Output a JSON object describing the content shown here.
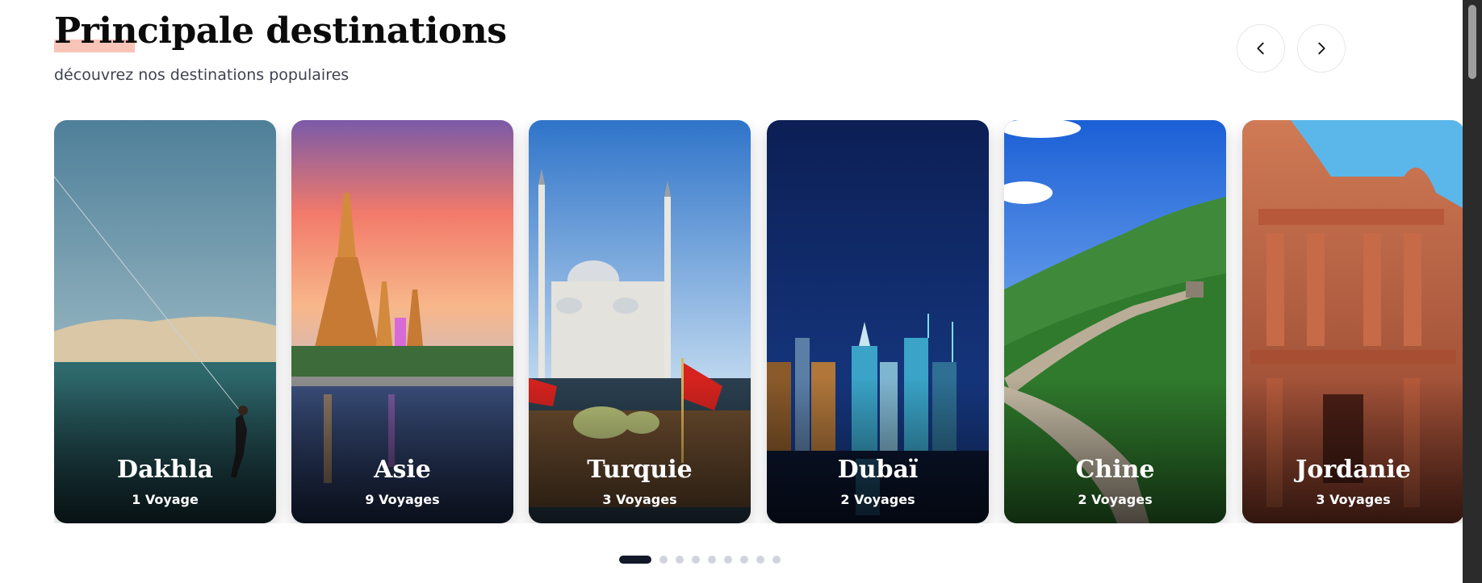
{
  "section": {
    "title": "Principale destinations",
    "subtitle": "découvrez nos destinations populaires"
  },
  "navigation": {
    "prev_icon": "chevron-left-icon",
    "next_icon": "chevron-right-icon"
  },
  "destinations": [
    {
      "name": "Dakhla",
      "count": "1 Voyage"
    },
    {
      "name": "Asie",
      "count": "9 Voyages"
    },
    {
      "name": "Turquie",
      "count": "3 Voyages"
    },
    {
      "name": "Dubaï",
      "count": "2 Voyages"
    },
    {
      "name": "Chine",
      "count": "2 Voyages"
    },
    {
      "name": "Jordanie",
      "count": "3 Voyages"
    }
  ],
  "pagination": {
    "total": 9,
    "active": 1
  },
  "colors": {
    "title": "#0b0b0b",
    "title_highlight": "#f8c4b8",
    "active_dot": "#111827",
    "inactive_dot": "#d1d5db"
  }
}
